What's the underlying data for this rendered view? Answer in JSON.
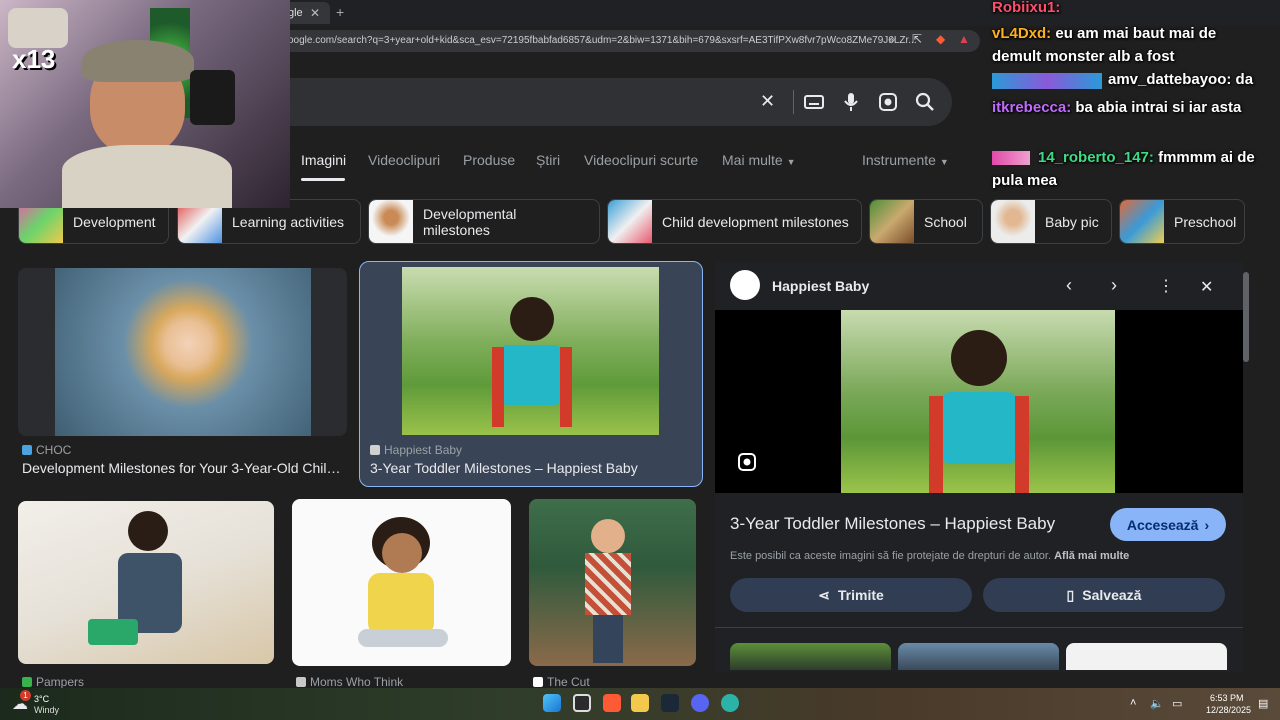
{
  "browser": {
    "tab_title": "gle",
    "tab_close": "✕",
    "new_tab": "+",
    "url": "oogle.com/search?q=3+year+old+kid&sca_esv=72195fbabfad6857&udm=2&biw=1371&bih=679&sxsrf=AE3TifPXw8fvr7pWco8ZMe79J6LZr..."
  },
  "nav_tabs": [
    "Imagini",
    "Videoclipuri",
    "Produse",
    "Știri",
    "Videoclipuri scurte",
    "Mai multe",
    "Instrumente"
  ],
  "chips": [
    "Development",
    "Learning activities",
    "Developmental milestones",
    "Child development milestones",
    "School",
    "Baby pic",
    "Preschool"
  ],
  "results": [
    {
      "source": "CHOC",
      "title": "Development Milestones for Your 3-Year-Old Child ..."
    },
    {
      "source": "Happiest Baby",
      "title": "3-Year Toddler Milestones – Happiest Baby"
    },
    {
      "source": "Pampers",
      "title": ""
    },
    {
      "source": "Moms Who Think",
      "title": ""
    },
    {
      "source": "The Cut",
      "title": ""
    }
  ],
  "panel": {
    "site": "Happiest Baby",
    "title": "3-Year Toddler Milestones – Happiest Baby",
    "visit_label": "Accesează",
    "copyright": "Este posibil ca aceste imagini să fie protejate de drepturi de autor.",
    "learn_more": "Află mai multe",
    "share_label": "Trimite",
    "save_label": "Salvează"
  },
  "webcam": {
    "badge": "x13"
  },
  "chat": [
    {
      "user": "Robiixu1:",
      "text": "",
      "color": "#ff4d6d"
    },
    {
      "user": "vL4Dxd:",
      "text": "eu am mai baut mai de demult monster alb a fost",
      "color": "#ffb020"
    },
    {
      "user": "amv_dattebayoo:",
      "text": "da",
      "color": "#ffffff"
    },
    {
      "user": "itkrebecca:",
      "text": "ba abia intrai si iar asta",
      "color": "#c06bff"
    },
    {
      "user": "14_roberto_147:",
      "text": "fmmmm ai de pula mea",
      "color": "#3ddc84"
    }
  ],
  "taskbar": {
    "temp": "3°C",
    "weather": "Windy",
    "time": "6:53 PM",
    "date": "12/28/2025",
    "notif_count": "1"
  },
  "colors": {
    "accent": "#8ab4f8",
    "panel_bg": "#202124",
    "page_bg": "#1f1f1f"
  }
}
